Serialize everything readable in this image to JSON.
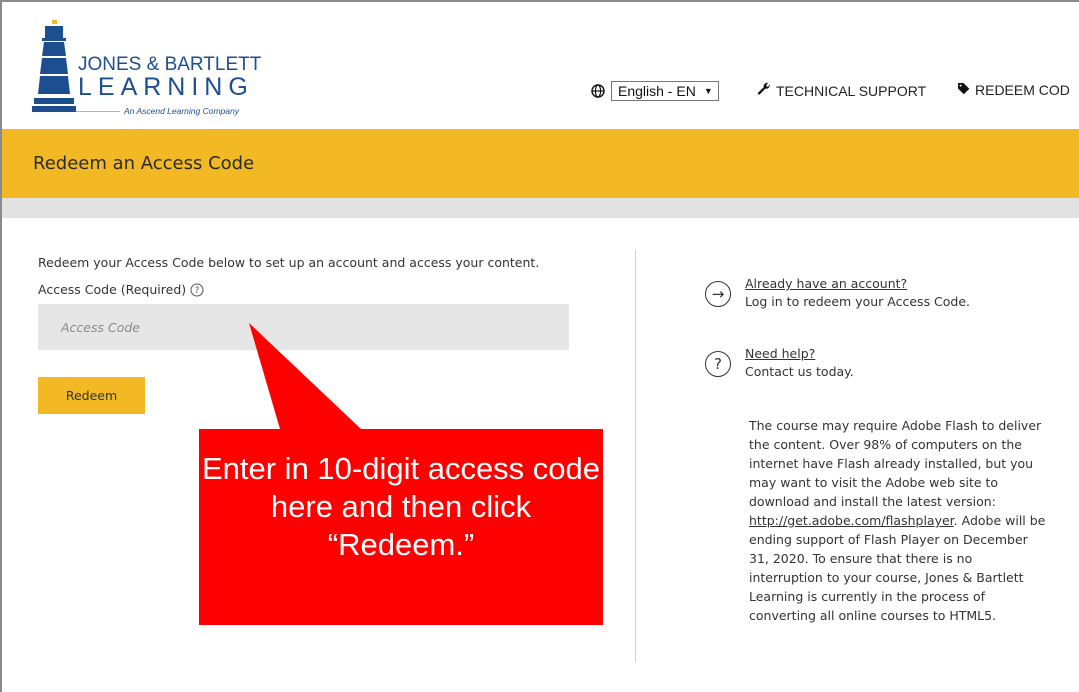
{
  "header": {
    "logo": {
      "line1": "JONES & BARTLETT",
      "line2": "LEARNING",
      "tagline": "An Ascend Learning Company"
    },
    "language": {
      "selected": "English - EN"
    },
    "nav": {
      "support": "TECHNICAL SUPPORT",
      "redeem": "REDEEM COD"
    }
  },
  "title_bar": {
    "title": "Redeem an Access Code"
  },
  "form": {
    "intro": "Redeem your Access Code below to set up an account and access your content.",
    "label": "Access Code (Required)",
    "placeholder": "Access Code",
    "button": "Redeem"
  },
  "sidebar": {
    "account_link": "Already have an account?",
    "account_text": "Log in to redeem your Access Code.",
    "help_link": "Need help?",
    "help_text": "Contact us today.",
    "flash_before": "The course may require Adobe Flash to deliver the content. Over 98% of computers on the internet have Flash already installed, but you may want to visit the Adobe web site to download and install the latest version: ",
    "flash_link": "http://get.adobe.com/flashplayer",
    "flash_after": ". Adobe will be ending support of Flash Player on December 31, 2020. To ensure that there is no interruption to your course, Jones & Bartlett Learning is currently in the process of converting all online courses to HTML5."
  },
  "callout": {
    "text": "Enter in 10-digit access code here and then click “Redeem.”"
  },
  "colors": {
    "accent": "#f2b924",
    "brand": "#1d4e8f",
    "callout": "#ff0000"
  }
}
